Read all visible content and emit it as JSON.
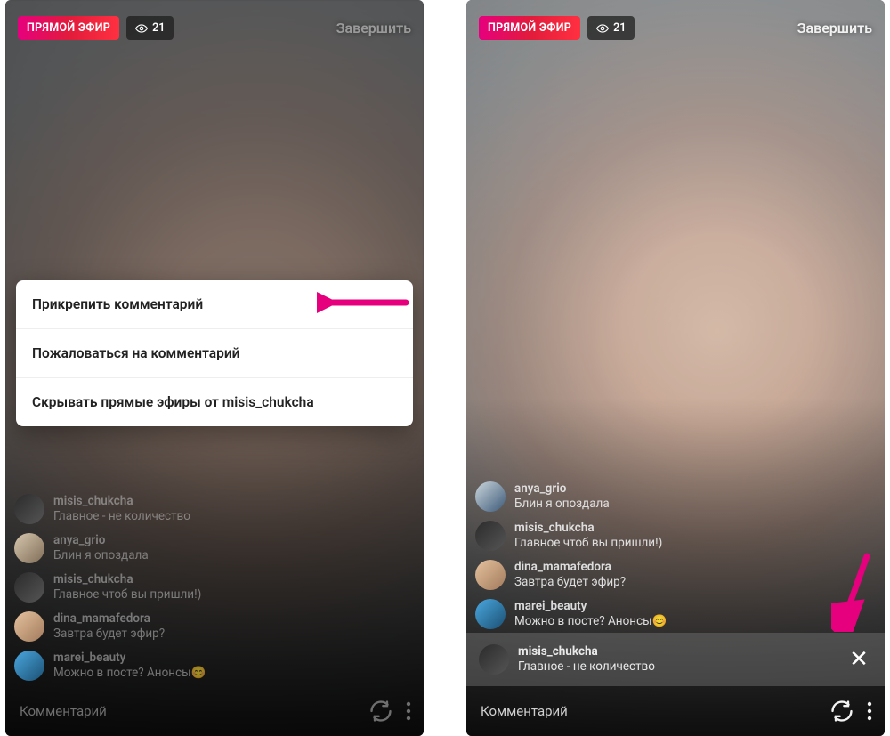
{
  "common": {
    "live_badge": "ПРЯМОЙ ЭФИР",
    "viewer_count": "21",
    "end_label": "Завершить",
    "comment_placeholder": "Комментарий"
  },
  "left": {
    "sheet": {
      "pin": "Прикрепить комментарий",
      "report": "Пожаловаться на комментарий",
      "hide": "Скрывать прямые эфиры от misis_chukcha"
    },
    "comments": [
      {
        "user": "misis_chukcha",
        "text": "Главное - не количество"
      },
      {
        "user": "anya_grio",
        "text": "Блин я опоздала"
      },
      {
        "user": "misis_chukcha",
        "text": "Главное чтоб вы пришли!)"
      },
      {
        "user": "dina_mamafedora",
        "text": "Завтра будет эфир?"
      },
      {
        "user": "marei_beauty",
        "text": "Можно в посте? Анонсы😊"
      }
    ]
  },
  "right": {
    "comments": [
      {
        "user": "anya_grio",
        "text": "Блин я опоздала"
      },
      {
        "user": "misis_chukcha",
        "text": "Главное чтоб вы пришли!)"
      },
      {
        "user": "dina_mamafedora",
        "text": "Завтра будет эфир?"
      },
      {
        "user": "marei_beauty",
        "text": "Можно в посте? Анонсы😊"
      }
    ],
    "pinned": {
      "user": "misis_chukcha",
      "text": "Главное - не количество",
      "close": "✕"
    }
  }
}
